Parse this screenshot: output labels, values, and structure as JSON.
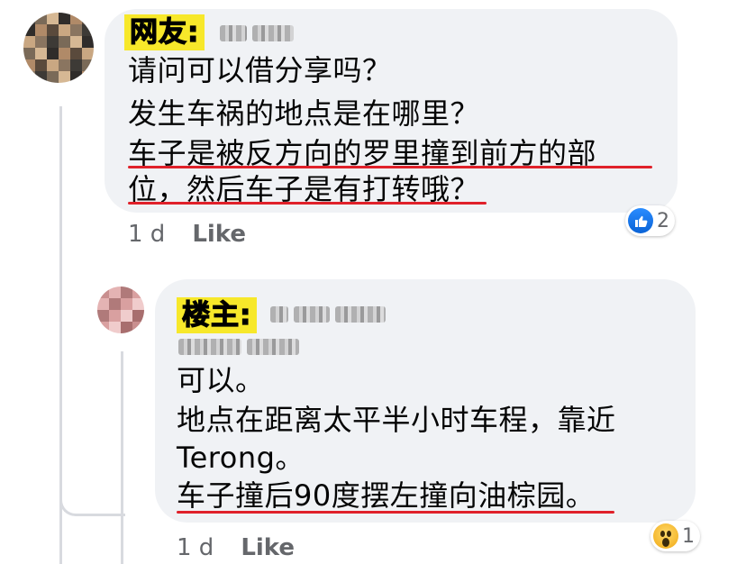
{
  "colors": {
    "bubble_bg": "#f0f2f5",
    "highlight_tag": "#f7e82a",
    "underline": "#e0212a",
    "meta_text": "#65676b",
    "like_blue": "#1877f2"
  },
  "comments": [
    {
      "tag": "网友:",
      "lines": [
        "请问可以借分享吗？",
        "发生车祸的地点是在哪里？",
        "车子是被反方向的罗里撞到前方的部",
        "位，然后车子是有打转哦？"
      ],
      "time": "1 d",
      "like_label": "Like",
      "reaction_icon": "like-icon",
      "reaction_count": "2"
    },
    {
      "tag": "楼主:",
      "lines": [
        "可以。",
        "地点在距离太平半小时车程，靠近",
        "Terong。",
        "车子撞后90度摆左撞向油棕园。"
      ],
      "time": "1 d",
      "like_label": "Like",
      "reaction_icon": "wow-icon",
      "reaction_count": "1"
    }
  ]
}
